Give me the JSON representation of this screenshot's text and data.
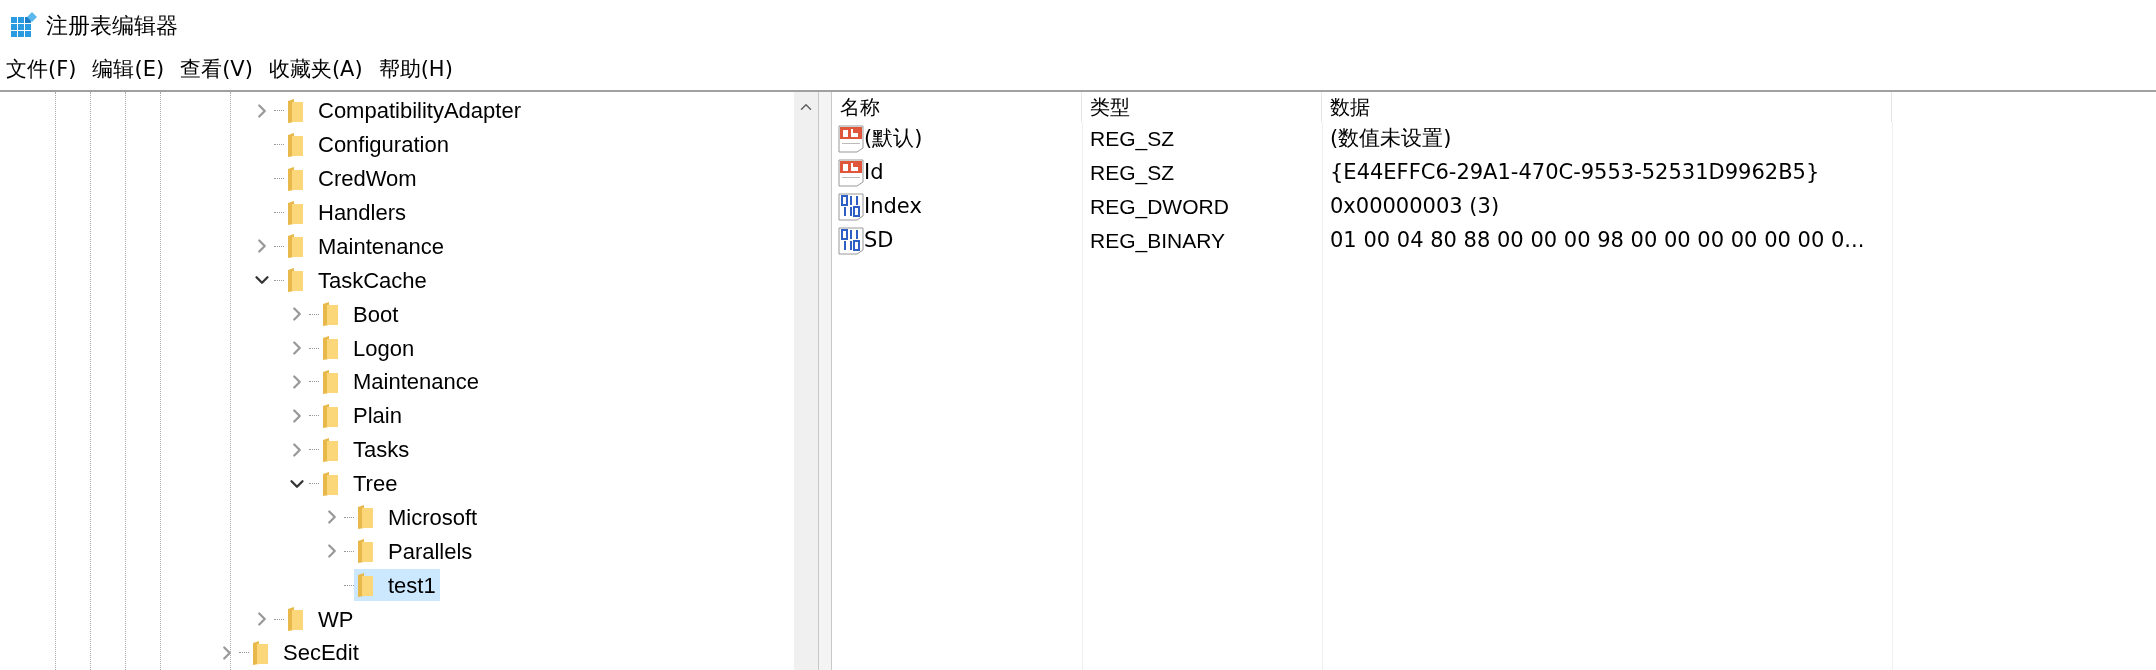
{
  "window": {
    "title": "注册表编辑器"
  },
  "menu": [
    "文件(F)",
    "编辑(E)",
    "查看(V)",
    "收藏夹(A)",
    "帮助(H)"
  ],
  "tree": {
    "nodes": [
      {
        "children": [
          {
            "label": "CompatibilityAdapter",
            "expandable": true,
            "expanded": false,
            "selected": false
          },
          {
            "label": "Configuration",
            "expandable": false,
            "selected": false
          },
          {
            "label": "CredWom",
            "expandable": false,
            "selected": false
          },
          {
            "label": "Handlers",
            "expandable": false,
            "selected": false
          },
          {
            "label": "Maintenance",
            "expandable": true,
            "expanded": false,
            "selected": false
          },
          {
            "label": "TaskCache",
            "expandable": true,
            "expanded": true,
            "selected": false,
            "children": [
              {
                "label": "Boot",
                "expandable": true,
                "expanded": false,
                "selected": false
              },
              {
                "label": "Logon",
                "expandable": true,
                "expanded": false,
                "selected": false
              },
              {
                "label": "Maintenance",
                "expandable": true,
                "expanded": false,
                "selected": false
              },
              {
                "label": "Plain",
                "expandable": true,
                "expanded": false,
                "selected": false
              },
              {
                "label": "Tasks",
                "expandable": true,
                "expanded": false,
                "selected": false
              },
              {
                "label": "Tree",
                "expandable": true,
                "expanded": true,
                "selected": false,
                "children": [
                  {
                    "label": "Microsoft",
                    "expandable": true,
                    "expanded": false,
                    "selected": false
                  },
                  {
                    "label": "Parallels",
                    "expandable": true,
                    "expanded": false,
                    "selected": false
                  },
                  {
                    "label": "test1",
                    "expandable": false,
                    "selected": true
                  }
                ]
              }
            ]
          },
          {
            "label": "WP",
            "expandable": true,
            "expanded": false,
            "selected": false
          }
        ]
      },
      {
        "label": "SecEdit",
        "expandable": true,
        "expanded": false,
        "selected": false
      }
    ]
  },
  "values": {
    "columns": [
      "名称",
      "类型",
      "数据"
    ],
    "rows": [
      {
        "kind": "string",
        "name": "(默认)",
        "type": "REG_SZ",
        "data": "(数值未设置)"
      },
      {
        "kind": "string",
        "name": "Id",
        "type": "REG_SZ",
        "data": "{E44EFFC6-29A1-470C-9553-52531D9962B5}"
      },
      {
        "kind": "binary",
        "name": "Index",
        "type": "REG_DWORD",
        "data": "0x00000003 (3)"
      },
      {
        "kind": "binary",
        "name": "SD",
        "type": "REG_BINARY",
        "data": "01 00 04 80 88 00 00 00 98 00 00 00 00 00 00 0..."
      }
    ]
  }
}
